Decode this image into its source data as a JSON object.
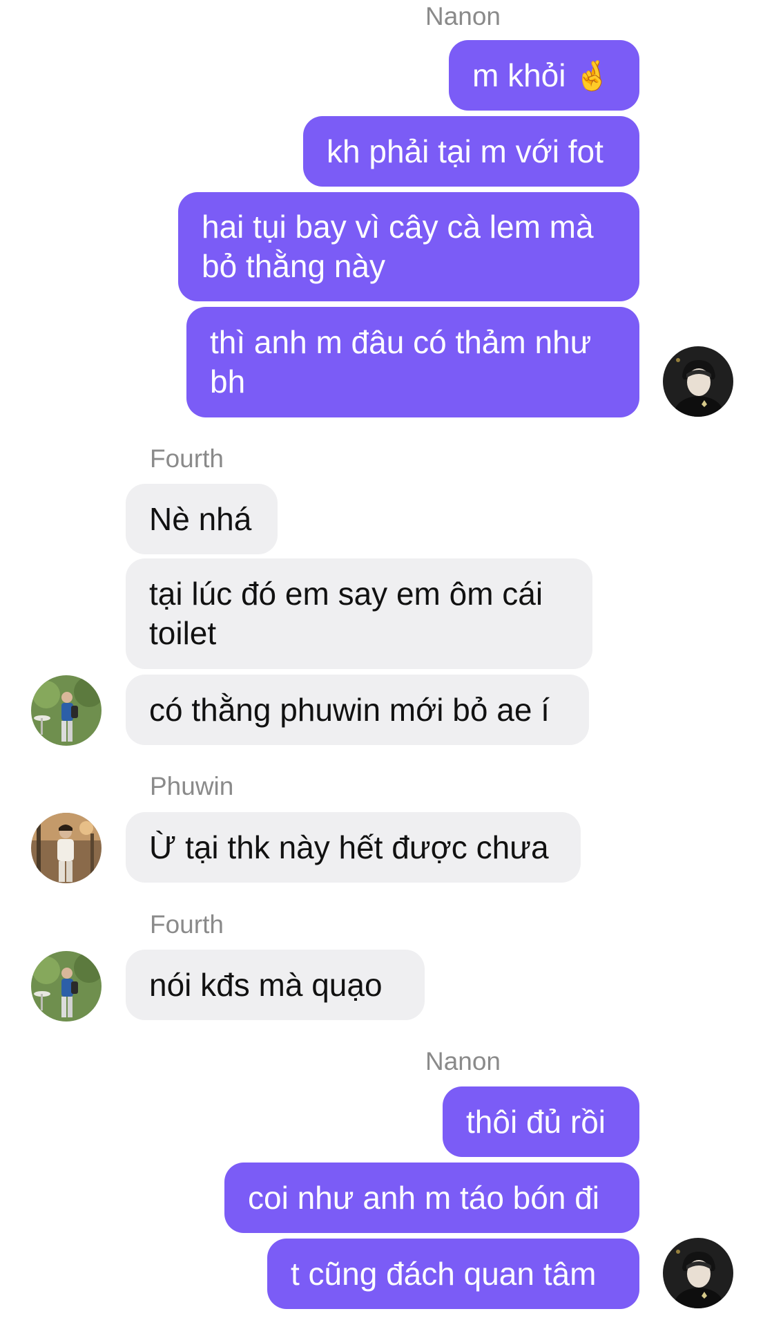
{
  "messages": [
    {
      "sender": "Nanon",
      "text": "m khỏi",
      "emoji": "🤞"
    },
    {
      "text": "kh phải tại m với fot"
    },
    {
      "line1": "hai tụi bay vì cây cà lem mà",
      "line2": "bỏ thằng này"
    },
    {
      "line1": "thì anh m đâu có thảm như",
      "line2": "bh"
    },
    {
      "sender": "Fourth",
      "text": "Nè nhá"
    },
    {
      "line1": "tại lúc đó em say em ôm cái",
      "line2": "toilet"
    },
    {
      "text": "có thằng phuwin mới bỏ ae í"
    },
    {
      "sender": "Phuwin",
      "text": "Ừ tại thk này hết được chưa"
    },
    {
      "sender": "Fourth",
      "text": "nói kđs mà quạo"
    },
    {
      "sender": "Nanon",
      "text": "thôi đủ rồi"
    },
    {
      "text": "coi như anh m táo bón đi"
    },
    {
      "text": "t cũng đách quan tâm"
    }
  ],
  "colors": {
    "outgoing": "#7b5cf6",
    "incoming": "#efeff1",
    "sender_name": "#8a8a8a"
  },
  "avatars": [
    "nanon-avatar",
    "fourth-avatar",
    "phuwin-avatar"
  ]
}
